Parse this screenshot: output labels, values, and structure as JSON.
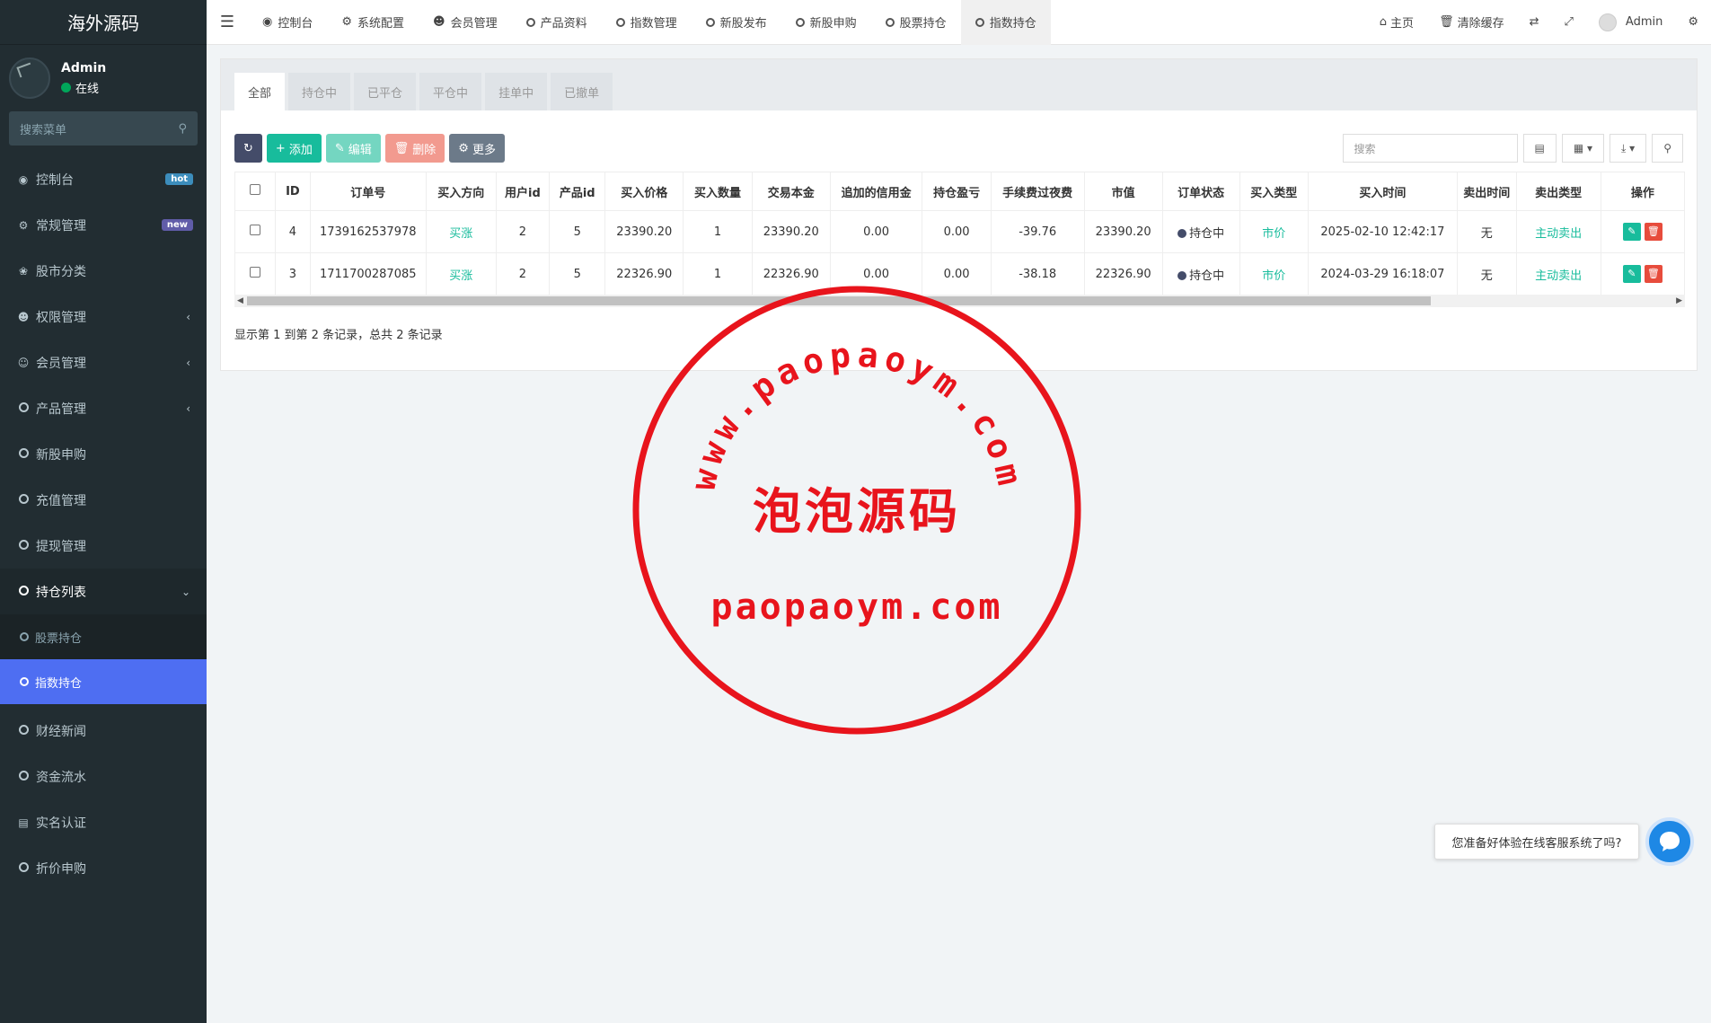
{
  "sidebar": {
    "logo": "海外源码",
    "user": {
      "name": "Admin",
      "status": "在线"
    },
    "search_placeholder": "搜索菜单",
    "items": [
      {
        "label": "控制台",
        "badge": "hot"
      },
      {
        "label": "常规管理",
        "badge": "new"
      },
      {
        "label": "股市分类"
      },
      {
        "label": "权限管理"
      },
      {
        "label": "会员管理"
      },
      {
        "label": "产品管理"
      },
      {
        "label": "新股申购"
      },
      {
        "label": "充值管理"
      },
      {
        "label": "提现管理"
      },
      {
        "label": "持仓列表"
      },
      {
        "label": "财经新闻"
      },
      {
        "label": "资金流水"
      },
      {
        "label": "实名认证"
      },
      {
        "label": "折价申购"
      }
    ],
    "sub_items": [
      {
        "label": "股票持仓"
      },
      {
        "label": "指数持仓"
      }
    ]
  },
  "header": {
    "tabs": [
      {
        "label": "控制台"
      },
      {
        "label": "系统配置"
      },
      {
        "label": "会员管理"
      },
      {
        "label": "产品资料"
      },
      {
        "label": "指数管理"
      },
      {
        "label": "新股发布"
      },
      {
        "label": "新股申购"
      },
      {
        "label": "股票持仓"
      },
      {
        "label": "指数持仓"
      }
    ],
    "home": "主页",
    "clear_cache": "清除缓存",
    "admin": "Admin"
  },
  "panel": {
    "tabs": [
      "全部",
      "持仓中",
      "已平仓",
      "平仓中",
      "挂单中",
      "已撤单"
    ],
    "buttons": {
      "add": "添加",
      "edit": "编辑",
      "delete": "删除",
      "more": "更多"
    },
    "search_placeholder": "搜索",
    "columns": [
      "ID",
      "订单号",
      "买入方向",
      "用户id",
      "产品id",
      "买入价格",
      "买入数量",
      "交易本金",
      "追加的信用金",
      "持仓盈亏",
      "手续费过夜费",
      "市值",
      "订单状态",
      "买入类型",
      "买入时间",
      "卖出时间",
      "卖出类型",
      "操作"
    ],
    "rows": [
      {
        "id": "4",
        "order": "1739162537978",
        "direction": "买涨",
        "user_id": "2",
        "product_id": "5",
        "price": "23390.20",
        "qty": "1",
        "principal": "23390.20",
        "credit": "0.00",
        "pnl": "0.00",
        "fee": "-39.76",
        "market_value": "23390.20",
        "status": "持仓中",
        "buy_type": "市价",
        "buy_time": "2025-02-10 12:42:17",
        "sell_time": "无",
        "sell_type": "主动卖出"
      },
      {
        "id": "3",
        "order": "1711700287085",
        "direction": "买涨",
        "user_id": "2",
        "product_id": "5",
        "price": "22326.90",
        "qty": "1",
        "principal": "22326.90",
        "credit": "0.00",
        "pnl": "0.00",
        "fee": "-38.18",
        "market_value": "22326.90",
        "status": "持仓中",
        "buy_type": "市价",
        "buy_time": "2024-03-29 16:18:07",
        "sell_time": "无",
        "sell_type": "主动卖出"
      }
    ],
    "footer": "显示第 1 到第 2 条记录，总共 2 条记录"
  },
  "watermark": {
    "arc_text": "www.paopaoym.com",
    "center_text": "泡泡源码",
    "bottom_text": "paopaoym.com"
  },
  "chat": {
    "prompt": "您准备好体验在线客服系统了吗?"
  },
  "colors": {
    "sidebar_bg": "#222d32",
    "active_blue": "#4e6ef2",
    "green": "#18bc9c",
    "stamp_red": "#e8141c"
  }
}
